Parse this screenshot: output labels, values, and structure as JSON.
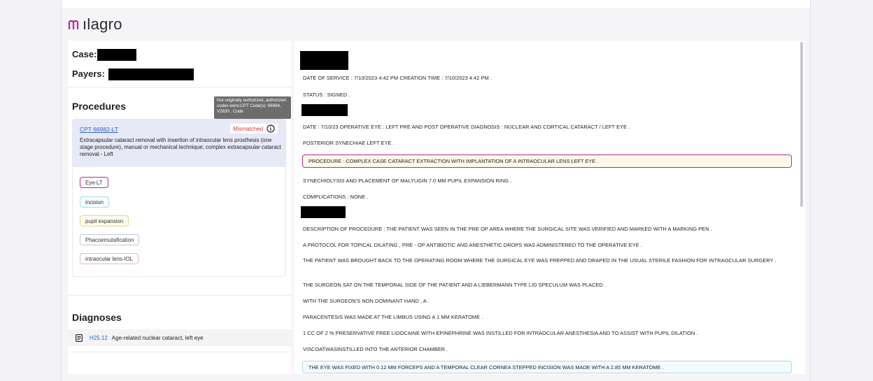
{
  "app": {
    "logo_text": "ılagro",
    "brand_color": "#b62c8c"
  },
  "left": {
    "case_label": "Case:",
    "payers_label": "Payers:",
    "procedures_title": "Procedures",
    "tooltip_text": "Not originally authorized, authorized codes were:CPT Code(s): 66984, V2630 , Code",
    "procedure": {
      "code": "CPT 66982-LT",
      "status": "Mismatched",
      "status_icon": "info-icon",
      "description": "Extracapsular cataract removal with insertion of intraocular lens prosthesis (one stage procedure), manual or mechanical technique; complex extracapsular cataract removal - Left",
      "tags": [
        "Eye-LT",
        "incision",
        "pupil expansion",
        "Phacoemulsification",
        "intraocular lens-IOL"
      ]
    },
    "diagnoses_title": "Diagnoses",
    "diagnosis": {
      "icon": "document-icon",
      "code": "H25.12",
      "text": "Age-related nuclear cataract, left eye"
    }
  },
  "note": {
    "date_of_service": "DATE OF SERVICE : 7/10/2023 4:42 PM CREATION TIME : 7/10/2023 4:42 PM .",
    "status": "STATUS : SIGNED .",
    "date_line": "DATE : 7/10/23 OPERATIVE EYE : LEFT PRE AND POST OPERATIVE DIAGNOSIS : NUCLEAR AND CORTICAL CATARACT / LEFT EYE .",
    "posterior": "POSTERIOR SYNECHIAE LEFT EYE .",
    "procedure": "PROCEDURE : COMPLEX CASE CATARACT EXTRACTION WITH IMPLANTATION OF A INTRAOCULAR LENS LEFT EYE .",
    "synechiolysis": "SYNECHIOLYSIS AND PLACEMENT OF MALYUGIN 7.0 MM PUPIL EXPANSION RING .",
    "complications": "COMPLICATIONS : NONE .",
    "description": "DESCRIPTION OF PROCEDURE : THE PATIENT WAS SEEN IN THE PRE OP AREA WHERE THE SURGICAL SITE WAS VERIFIED AND MARKED WITH A MARKING PEN .",
    "protocol": "A PROTOCOL FOR TOPICAL DILATING , PRE - OP ANTIBIOTIC AND ANESTHETIC DROPS WAS ADMINISTERED TO THE OPERATIVE EYE .",
    "brought_back": "THE PATIENT WAS BROUGHT BACK TO THE OPERATING ROOM WHERE THE SURGICAL EYE WAS PREPPED AND DRAPED IN THE USUAL STERILE FASHION FOR INTRAOCULAR SURGERY .",
    "surgeon_sat": "THE SURGEON SAT ON THE TEMPORAL SIDE OF THE PATIENT AND A LIEBERMANN TYPE LID SPECULUM WAS PLACED .",
    "non_dominant": "WITH THE SURGEON'S NON DOMINANT HAND , A .",
    "paracentesis": "PARACENTESIS WAS MADE AT THE LIMBUS USING A 1 MM KERATOME .",
    "lidocaine": "1 CC OF 2 % PRESERVATIVE FREE LIDOCAINE WITH EPINEPHRINE WAS INSTILLED FOR INTRAOCULAR ANESTHESIA AND TO ASSIST WITH PUPIL DILATION .",
    "viscoat": "VISCOATWASINSTILLED INTO THE ANTERIOR CHAMBER .",
    "eye_fixed": "THE EYE WAS FIXED WITH 0.12 MM FORCEPS AND A TEMPORAL CLEAR CORNEA STEPPED INCISION WAS MADE WITH A 2.85 MM KERATOME ."
  }
}
